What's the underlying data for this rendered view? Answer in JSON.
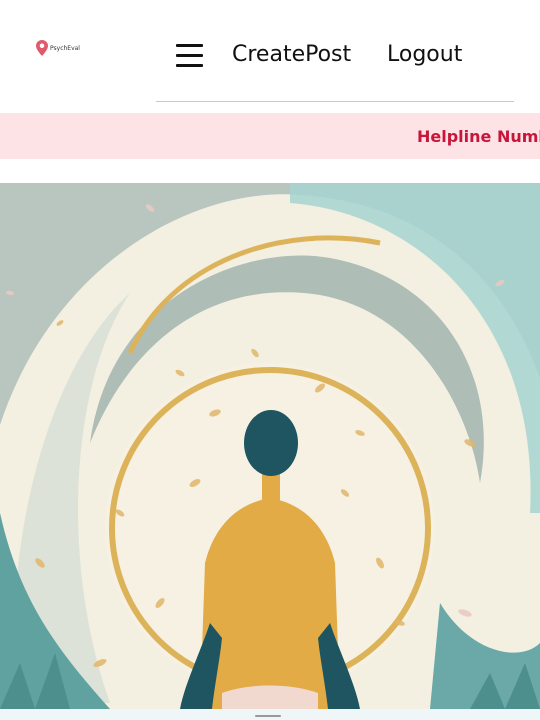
{
  "header": {
    "logo_text": "PsychEval",
    "nav": {
      "create_post": "CreatePost",
      "logout": "Logout"
    }
  },
  "helpline": {
    "text": "Helpline Numl"
  },
  "icons": {
    "menu": "hamburger-menu-icon",
    "logo": "location-pin-icon"
  },
  "colors": {
    "helpline_bg": "#fde3e6",
    "helpline_text": "#c8153a",
    "figure_body": "#e2ab45",
    "figure_head": "#1f5560",
    "halo": "#ddb35a"
  }
}
